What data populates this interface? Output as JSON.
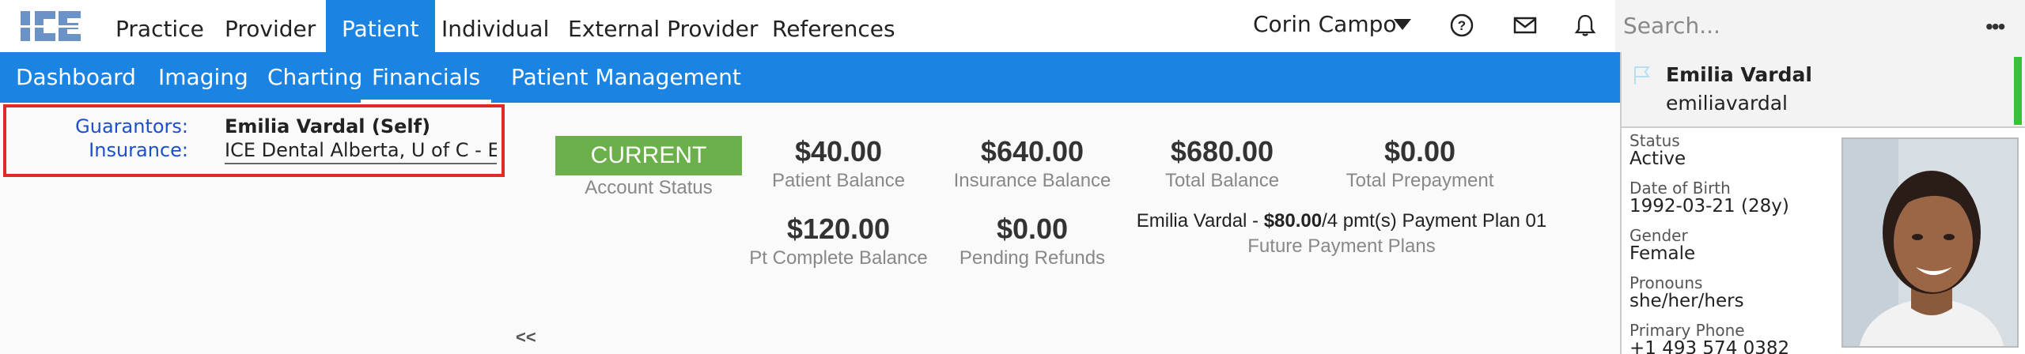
{
  "app": {
    "logo_text": "ICE",
    "brand_color": "#1b84e2"
  },
  "topnav": {
    "items": [
      {
        "label": "Practice"
      },
      {
        "label": "Provider"
      },
      {
        "label": "Patient",
        "active": true
      },
      {
        "label": "Individual"
      },
      {
        "label": "External Provider"
      },
      {
        "label": "References"
      }
    ],
    "user_name": "Corin Campo",
    "icons": [
      "help-icon",
      "mail-icon",
      "bell-icon"
    ]
  },
  "search": {
    "placeholder": "Search...",
    "value": "",
    "more_icon": "ellipsis-icon"
  },
  "subnav": {
    "items": [
      {
        "label": "Dashboard"
      },
      {
        "label": "Imaging"
      },
      {
        "label": "Charting"
      },
      {
        "label": "Financials",
        "active": true
      },
      {
        "label": "Patient Management"
      }
    ]
  },
  "financials": {
    "guarantors_label": "Guarantors:",
    "guarantors_value": "Emilia Vardal (Self)",
    "insurance_label": "Insurance:",
    "insurance_value": "ICE Dental Alberta, U of C - E...",
    "account_status": {
      "value": "CURRENT",
      "label": "Account Status",
      "color": "#6cb04c"
    },
    "stats": {
      "patient_balance": {
        "value": "$40.00",
        "label": "Patient Balance"
      },
      "insurance_balance": {
        "value": "$640.00",
        "label": "Insurance Balance"
      },
      "total_balance": {
        "value": "$680.00",
        "label": "Total Balance"
      },
      "total_prepayment": {
        "value": "$0.00",
        "label": "Total Prepayment"
      },
      "pt_complete_balance": {
        "value": "$120.00",
        "label": "Pt Complete Balance"
      },
      "pending_refunds": {
        "value": "$0.00",
        "label": "Pending Refunds"
      }
    },
    "payment_plan": {
      "prefix": "Emilia Vardal - ",
      "amount": "$80.00",
      "suffix": "/4 pmt(s) Payment Plan 01",
      "label": "Future Payment Plans"
    },
    "collapse_label": "<<"
  },
  "patient_panel": {
    "name": "Emilia Vardal",
    "username": "emiliavardal",
    "status_color": "#34c534",
    "fields": [
      {
        "label": "Status",
        "value": "Active"
      },
      {
        "label": "Date of Birth",
        "value": "1992-03-21 (28y)"
      },
      {
        "label": "Gender",
        "value": "Female"
      },
      {
        "label": "Pronouns",
        "value": "she/her/hers"
      },
      {
        "label": "Primary Phone",
        "value": "+1 493 574 0382"
      }
    ]
  }
}
